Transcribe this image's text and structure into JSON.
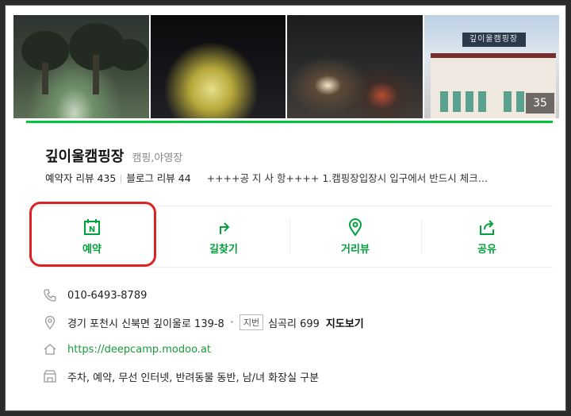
{
  "photos": {
    "count": "35",
    "sign_text": "깊이울캠핑장"
  },
  "place": {
    "name": "깊이울캠핑장",
    "category": "캠핑,야영장",
    "booking_reviews": "예약자 리뷰 435",
    "blog_reviews": "블로그 리뷰 44",
    "notice": "++++공 지 사 항++++ 1.캠핑장입장시 입구에서 반드시 체크…"
  },
  "actions": [
    {
      "label": "예약",
      "icon": "calendar-n-icon"
    },
    {
      "label": "길찾기",
      "icon": "directions-arrow-icon"
    },
    {
      "label": "거리뷰",
      "icon": "street-view-pin-icon"
    },
    {
      "label": "공유",
      "icon": "share-icon"
    }
  ],
  "info": {
    "phone": "010-6493-8789",
    "address": "경기 포천시 신북면 깊이울로 139-8",
    "jibun_badge": "지번",
    "jibun": "심곡리 699",
    "map_link": "지도보기",
    "url": "https://deepcamp.modoo.at",
    "amenities": "주차, 예약, 무선 인터넷, 반려동물 동반, 남/녀 화장실 구분"
  },
  "colors": {
    "accent": "#00c73c",
    "highlight": "#dd2222",
    "link": "#1a9a3a"
  }
}
